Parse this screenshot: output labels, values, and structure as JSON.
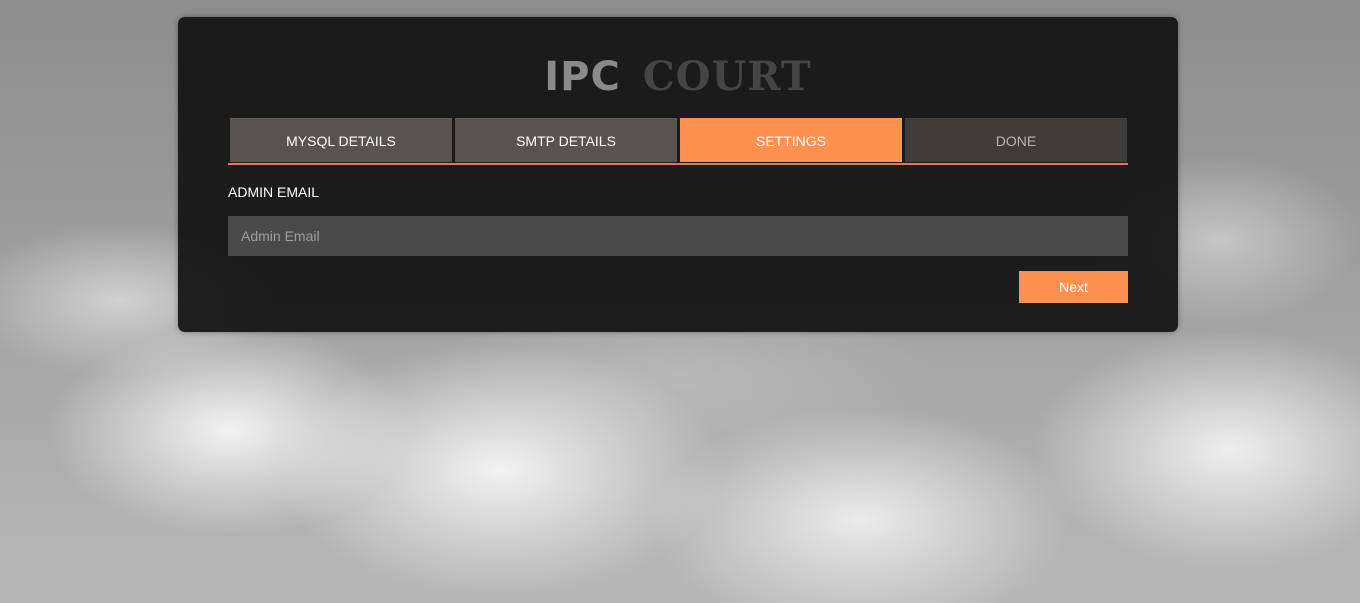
{
  "brand": {
    "part1": "IPC",
    "part2": "COURT"
  },
  "tabs": [
    {
      "label": "MYSQL DETAILS",
      "state": "completed"
    },
    {
      "label": "SMTP DETAILS",
      "state": "completed"
    },
    {
      "label": "SETTINGS",
      "state": "active"
    },
    {
      "label": "DONE",
      "state": "pending"
    }
  ],
  "form": {
    "admin_email_label": "ADMIN EMAIL",
    "admin_email_placeholder": "Admin Email",
    "admin_email_value": "",
    "next_label": "Next"
  },
  "colors": {
    "accent": "#ff9150",
    "tab_underline": "#e0796a",
    "panel": "#121212"
  }
}
